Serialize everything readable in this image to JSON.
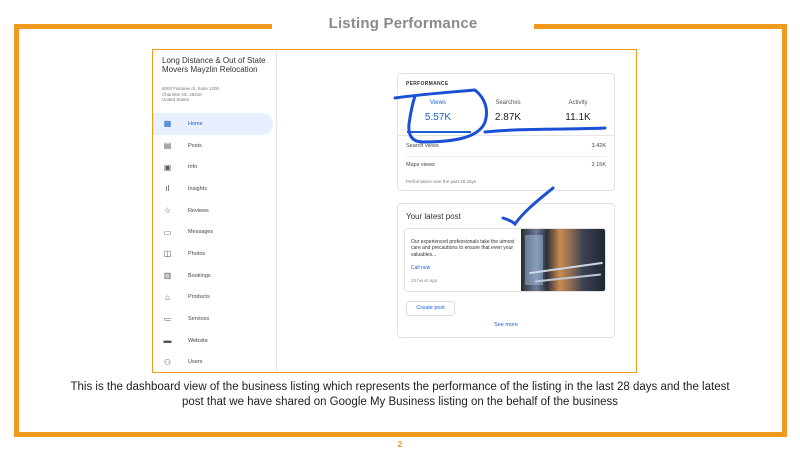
{
  "slide": {
    "title": "Listing Performance",
    "caption": "This is the dashboard view of the business listing which represents the performance of the listing in the last 28 days and the latest post that we have shared on Google My Business listing on the behalf of the business",
    "page_number": "2",
    "accent_color": "#f29a1f"
  },
  "business": {
    "name": "Long Distance & Out of State Movers Mayzlin Relocation",
    "address_line1": "6000 Fairview dr, Suite 1200",
    "address_line2": "Charlotte NC 28210",
    "address_line3": "United States"
  },
  "sidebar": {
    "items": [
      {
        "label": "Home",
        "icon": "home-icon",
        "active": true
      },
      {
        "label": "Posts",
        "icon": "posts-icon"
      },
      {
        "label": "Info",
        "icon": "info-icon"
      },
      {
        "label": "Insights",
        "icon": "insights-icon"
      },
      {
        "label": "Reviews",
        "icon": "reviews-icon"
      },
      {
        "label": "Messages",
        "icon": "messages-icon"
      },
      {
        "label": "Photos",
        "icon": "photos-icon"
      },
      {
        "label": "Bookings",
        "icon": "bookings-icon"
      },
      {
        "label": "Products",
        "icon": "products-icon"
      },
      {
        "label": "Services",
        "icon": "services-icon"
      },
      {
        "label": "Website",
        "icon": "website-icon"
      },
      {
        "label": "Users",
        "icon": "users-icon"
      }
    ]
  },
  "performance": {
    "heading": "PERFORMANCE",
    "metrics": [
      {
        "label": "Views",
        "value": "5.57K"
      },
      {
        "label": "Searches",
        "value": "2.87K"
      },
      {
        "label": "Activity",
        "value": "11.1K"
      }
    ],
    "rows": [
      {
        "label": "Search views",
        "value": "3.42K"
      },
      {
        "label": "Maps views",
        "value": "2.15K"
      }
    ],
    "note": "Performance over the past 28 days"
  },
  "latest_post": {
    "heading": "Your latest post",
    "text": "Our experienced professionals take the utmost care and precautions to ensure that even your valuables...",
    "link": "Call now",
    "time": "23 hours ago",
    "create_button": "Create post",
    "see_more": "See more"
  }
}
